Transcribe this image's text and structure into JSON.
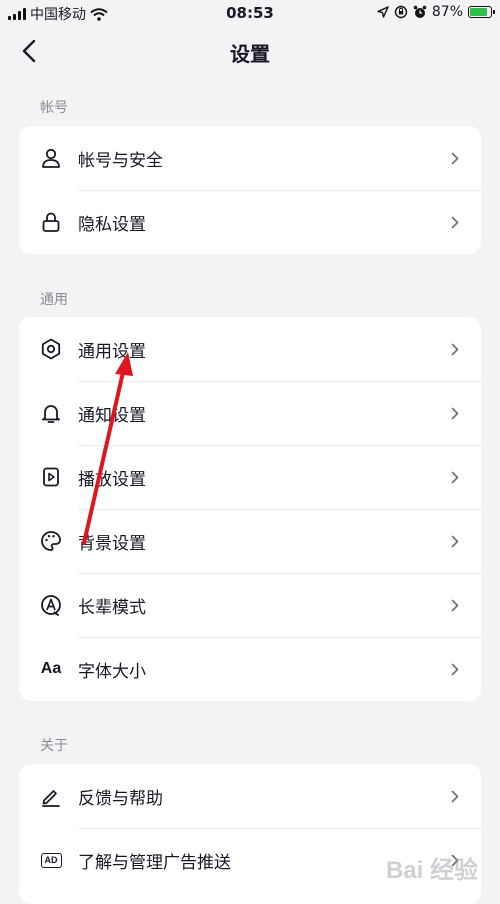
{
  "status_bar": {
    "carrier": "中国移动",
    "time": "08:53",
    "battery_percent": "87%",
    "battery_level": 0.87,
    "icons": [
      "signal-icon",
      "wifi-icon",
      "location-icon",
      "lock-rotation-icon",
      "alarm-icon",
      "battery-icon"
    ]
  },
  "nav": {
    "title": "设置",
    "back_icon": "chevron-left-icon"
  },
  "sections": [
    {
      "header": "帐号",
      "items": [
        {
          "label": "帐号与安全",
          "icon": "person-icon"
        },
        {
          "label": "隐私设置",
          "icon": "lock-icon"
        }
      ]
    },
    {
      "header": "通用",
      "items": [
        {
          "label": "通用设置",
          "icon": "gear-icon"
        },
        {
          "label": "通知设置",
          "icon": "bell-icon"
        },
        {
          "label": "播放设置",
          "icon": "play-icon"
        },
        {
          "label": "背景设置",
          "icon": "palette-icon"
        },
        {
          "label": "长辈模式",
          "icon": "elder-mode-icon"
        },
        {
          "label": "字体大小",
          "icon": "font-size-icon",
          "icon_text": "Aa"
        }
      ]
    },
    {
      "header": "关于",
      "items": [
        {
          "label": "反馈与帮助",
          "icon": "pencil-icon"
        },
        {
          "label": "了解与管理广告推送",
          "icon": "ad-icon",
          "icon_text": "AD"
        }
      ]
    }
  ],
  "colors": {
    "background": "#f3f3f5",
    "card": "#ffffff",
    "text": "#161823",
    "secondary_text": "#8a8b91",
    "annotation_arrow": "#e0161e",
    "battery": "#2ec04b"
  },
  "watermark": "Bai 经验"
}
